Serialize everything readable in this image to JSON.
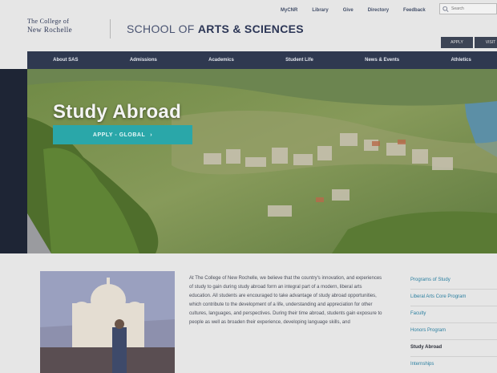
{
  "utility_nav": [
    "MyCNR",
    "Library",
    "Give",
    "Directory",
    "Feedback"
  ],
  "search": {
    "placeholder": "Search"
  },
  "logo": {
    "line1": "The College of",
    "line2": "New Rochelle"
  },
  "school": {
    "prefix": "SCHOOL OF ",
    "name": "ARTS & SCIENCES"
  },
  "mini_buttons": [
    "APPLY",
    "VISIT"
  ],
  "main_nav": [
    "About SAS",
    "Admissions",
    "Academics",
    "Student Life",
    "News & Events",
    "Athletics"
  ],
  "hero": {
    "title": "Study Abroad",
    "cta": "APPLY - GLOBAL",
    "cta_arrow": "›"
  },
  "body_text": "At The College of New Rochelle, we believe that the country's innovation, and experiences of study to gain during study abroad form an integral part of a modern, liberal arts education. All students are encouraged to take advantage of study abroad opportunities, which contribute to the development of a life, understanding and appreciation for other cultures, languages, and perspectives. During their time abroad, students gain exposure to people as well as broaden their experience, developing language skills, and",
  "side_nav": [
    {
      "label": "Programs of Study",
      "active": false
    },
    {
      "label": "Liberal Arts Core Program",
      "active": false
    },
    {
      "label": "Faculty",
      "active": false
    },
    {
      "label": "Honors Program",
      "active": false
    },
    {
      "label": "Study Abroad",
      "active": true
    },
    {
      "label": "Internships",
      "active": false
    }
  ],
  "colors": {
    "nav": "#2f3950",
    "accent": "#2aa7a9",
    "link": "#2b7fa0"
  }
}
